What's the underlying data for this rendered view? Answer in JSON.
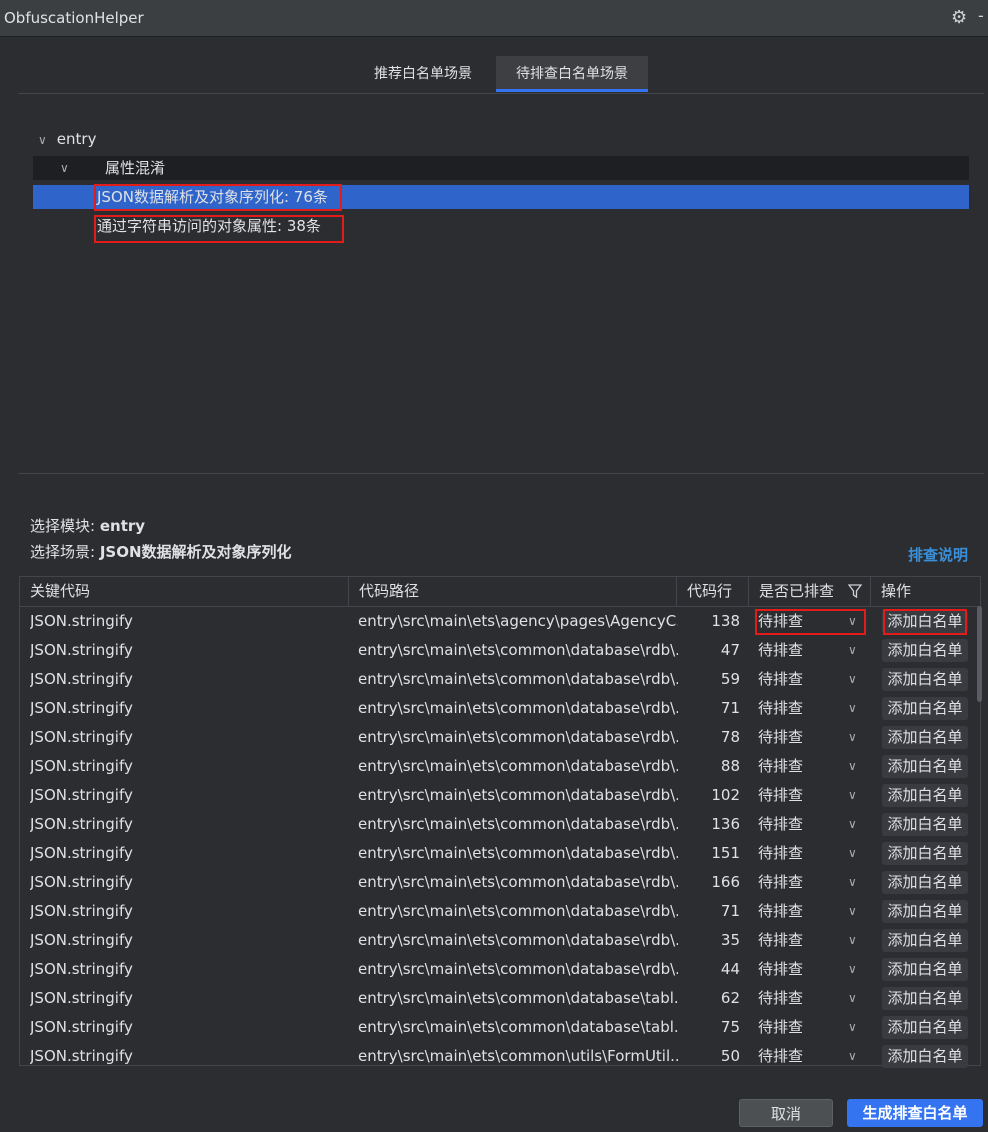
{
  "window": {
    "title": "ObfuscationHelper",
    "settings_icon": "gear-icon",
    "menu_glyph": "-"
  },
  "tabs": [
    {
      "label": "推荐白名单场景",
      "active": false
    },
    {
      "label": "待排查白名单场景",
      "active": true
    }
  ],
  "tree": {
    "root": "entry",
    "group": "属性混淆",
    "items": [
      {
        "label": "JSON数据解析及对象序列化: 76条",
        "selected": true
      },
      {
        "label": "通过字符串访问的对象属性: 38条",
        "selected": false
      }
    ]
  },
  "info": {
    "module_label": "选择模块:",
    "module_value": "entry",
    "scene_label": "选择场景:",
    "scene_value": "JSON数据解析及对象序列化",
    "help_link": "排查说明"
  },
  "table": {
    "headers": [
      "关键代码",
      "代码路径",
      "代码行",
      "是否已排查",
      "操作"
    ],
    "rows": [
      {
        "code": "JSON.stringify",
        "path": "entry\\src\\main\\ets\\agency\\pages\\AgencyC...",
        "line": "138",
        "status": "待排查",
        "action": "添加白名单"
      },
      {
        "code": "JSON.stringify",
        "path": "entry\\src\\main\\ets\\common\\database\\rdb\\...",
        "line": "47",
        "status": "待排查",
        "action": "添加白名单"
      },
      {
        "code": "JSON.stringify",
        "path": "entry\\src\\main\\ets\\common\\database\\rdb\\...",
        "line": "59",
        "status": "待排查",
        "action": "添加白名单"
      },
      {
        "code": "JSON.stringify",
        "path": "entry\\src\\main\\ets\\common\\database\\rdb\\...",
        "line": "71",
        "status": "待排查",
        "action": "添加白名单"
      },
      {
        "code": "JSON.stringify",
        "path": "entry\\src\\main\\ets\\common\\database\\rdb\\...",
        "line": "78",
        "status": "待排查",
        "action": "添加白名单"
      },
      {
        "code": "JSON.stringify",
        "path": "entry\\src\\main\\ets\\common\\database\\rdb\\...",
        "line": "88",
        "status": "待排查",
        "action": "添加白名单"
      },
      {
        "code": "JSON.stringify",
        "path": "entry\\src\\main\\ets\\common\\database\\rdb\\...",
        "line": "102",
        "status": "待排查",
        "action": "添加白名单"
      },
      {
        "code": "JSON.stringify",
        "path": "entry\\src\\main\\ets\\common\\database\\rdb\\...",
        "line": "136",
        "status": "待排查",
        "action": "添加白名单"
      },
      {
        "code": "JSON.stringify",
        "path": "entry\\src\\main\\ets\\common\\database\\rdb\\...",
        "line": "151",
        "status": "待排查",
        "action": "添加白名单"
      },
      {
        "code": "JSON.stringify",
        "path": "entry\\src\\main\\ets\\common\\database\\rdb\\...",
        "line": "166",
        "status": "待排查",
        "action": "添加白名单"
      },
      {
        "code": "JSON.stringify",
        "path": "entry\\src\\main\\ets\\common\\database\\rdb\\...",
        "line": "71",
        "status": "待排查",
        "action": "添加白名单"
      },
      {
        "code": "JSON.stringify",
        "path": "entry\\src\\main\\ets\\common\\database\\rdb\\...",
        "line": "35",
        "status": "待排查",
        "action": "添加白名单"
      },
      {
        "code": "JSON.stringify",
        "path": "entry\\src\\main\\ets\\common\\database\\rdb\\...",
        "line": "44",
        "status": "待排查",
        "action": "添加白名单"
      },
      {
        "code": "JSON.stringify",
        "path": "entry\\src\\main\\ets\\common\\database\\tabl...",
        "line": "62",
        "status": "待排查",
        "action": "添加白名单"
      },
      {
        "code": "JSON.stringify",
        "path": "entry\\src\\main\\ets\\common\\database\\tabl...",
        "line": "75",
        "status": "待排查",
        "action": "添加白名单"
      },
      {
        "code": "JSON.stringify",
        "path": "entry\\src\\main\\ets\\common\\utils\\FormUtil...",
        "line": "50",
        "status": "待排查",
        "action": "添加白名单"
      }
    ]
  },
  "footer": {
    "cancel_label": "取消",
    "generate_label": "生成排查白名单"
  },
  "colors": {
    "accent": "#3574f0",
    "highlight_box": "#e21b1b",
    "selection": "#2f65ca",
    "link": "#3a8fd9"
  }
}
